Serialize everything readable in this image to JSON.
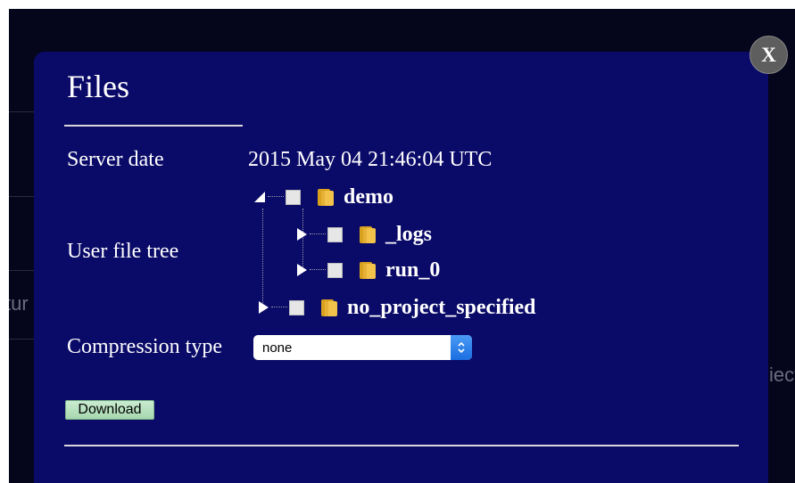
{
  "background": {
    "left_fragment": "tur",
    "right_fragment": "iect"
  },
  "dialog": {
    "title": "Files",
    "close_label": "X",
    "server_date": {
      "label": "Server date",
      "value": "2015 May 04 21:46:04 UTC"
    },
    "file_tree": {
      "label": "User file tree",
      "nodes": [
        {
          "label": "demo",
          "expanded": true
        },
        {
          "label": "_logs",
          "expanded": false
        },
        {
          "label": "run_0",
          "expanded": false
        },
        {
          "label": "no_project_specified",
          "expanded": false
        }
      ]
    },
    "compression": {
      "label": "Compression type",
      "selected": "none"
    },
    "download_label": "Download"
  },
  "colors": {
    "modal_bg": "#0a0a68",
    "backdrop": "#05051c",
    "download_button": "#b8e2bf",
    "select_accent": "#2a7fea"
  }
}
